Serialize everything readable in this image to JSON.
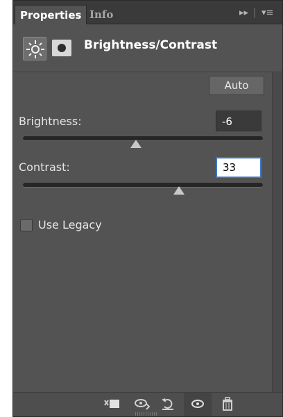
{
  "tabs": [
    {
      "label": "Properties",
      "active": true
    },
    {
      "label": "Info",
      "active": false
    }
  ],
  "tab_controls": {
    "collapse": "▸▸",
    "menu": "▾≡"
  },
  "header": {
    "title": "Brightness/Contrast",
    "adjustment_icon": "sun-icon",
    "mask_icon": "layer-mask-icon"
  },
  "auto_button": {
    "label": "Auto"
  },
  "brightness": {
    "label": "Brightness:",
    "value": "-6",
    "slider_fraction": 0.47
  },
  "contrast": {
    "label": "Contrast:",
    "value": "33",
    "slider_fraction": 0.65
  },
  "use_legacy": {
    "label": "Use Legacy",
    "checked": false
  },
  "footer_icons": [
    "clip-to-layer-icon",
    "view-previous-state-icon",
    "reset-icon",
    "visibility-eye-icon",
    "trash-icon"
  ],
  "colors": {
    "panel_bg": "#535353",
    "tab_bar": "#3a3a3a",
    "focus_border": "#3a78c8"
  }
}
